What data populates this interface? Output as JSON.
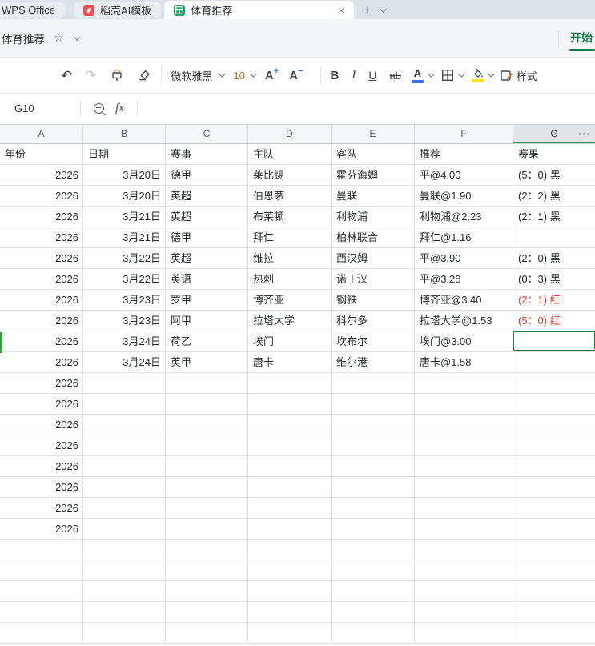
{
  "window_tabs": {
    "tabs": [
      {
        "label": "WPS Office",
        "icon": null,
        "active": false
      },
      {
        "label": "稻壳AI模板",
        "icon": "docer-leaf",
        "active": false
      },
      {
        "label": "体育推荐",
        "icon": "spreadsheet-grid",
        "active": true,
        "close_glyph": "×"
      }
    ],
    "new_tab_label": "+"
  },
  "title_bar": {
    "doc_title": "体育推荐",
    "star_glyph": "☆",
    "ribbon_active_tab": "开始"
  },
  "toolbar": {
    "undo_glyph": "↶",
    "redo_glyph": "↷",
    "font_name": "微软雅黑",
    "font_size": "10",
    "grow_font_letter": "A",
    "grow_font_sign": "+",
    "shrink_font_letter": "A",
    "shrink_font_sign": "−",
    "bold_label": "B",
    "italic_label": "I",
    "underline_label": "U",
    "strikethrough_label": "ab",
    "font_color_letter": "A",
    "styles_label": "样式"
  },
  "formula_bar": {
    "name_box": "G10",
    "fx_label": "fx"
  },
  "sheet": {
    "column_letters": [
      "A",
      "B",
      "C",
      "D",
      "E",
      "F",
      "G"
    ],
    "selected_column_index": 6,
    "selected_cell": "G10",
    "more_button": "···",
    "header_row": [
      "年份",
      "日期",
      "赛事",
      "主队",
      "客队",
      "推荐",
      "赛果"
    ],
    "rows": [
      {
        "year": "2026",
        "date": "3月20日",
        "league": "德甲",
        "home": "莱比锡",
        "away": "霍芬海姆",
        "tip": "平@4.00",
        "result": "(5：0) 黑",
        "result_color": "black",
        "selected": false
      },
      {
        "year": "2026",
        "date": "3月20日",
        "league": "英超",
        "home": "伯恩茅",
        "away": "曼联",
        "tip": "曼联@1.90",
        "result": "(2：2) 黑",
        "result_color": "black",
        "selected": false
      },
      {
        "year": "2026",
        "date": "3月21日",
        "league": "英超",
        "home": "布莱顿",
        "away": "利物浦",
        "tip": "利物浦@2.23",
        "result": "(2：1) 黑",
        "result_color": "black",
        "selected": false
      },
      {
        "year": "2026",
        "date": "3月21日",
        "league": "德甲",
        "home": "拜仁",
        "away": "柏林联合",
        "tip": "拜仁@1.16",
        "result": "",
        "result_color": "black",
        "selected": false
      },
      {
        "year": "2026",
        "date": "3月22日",
        "league": "英超",
        "home": "维拉",
        "away": "西汉姆",
        "tip": "平@3.90",
        "result": "(2：0) 黑",
        "result_color": "black",
        "selected": false
      },
      {
        "year": "2026",
        "date": "3月22日",
        "league": "英语",
        "home": "热刺",
        "away": "诺丁汉",
        "tip": "平@3.28",
        "result": "(0：3) 黑",
        "result_color": "black",
        "selected": false
      },
      {
        "year": "2026",
        "date": "3月23日",
        "league": "罗甲",
        "home": "博齐亚",
        "away": "钢铁",
        "tip": "博齐亚@3.40",
        "result": "(2：1) 红",
        "result_color": "red",
        "selected": false
      },
      {
        "year": "2026",
        "date": "3月23日",
        "league": "阿甲",
        "home": "拉塔大学",
        "away": "科尔多",
        "tip": "拉塔大学@1.53",
        "result": "(5：0) 红",
        "result_color": "red",
        "selected": false
      },
      {
        "year": "2026",
        "date": "3月24日",
        "league": "荷乙",
        "home": "埃门",
        "away": "坎布尔",
        "tip": "埃门@3.00",
        "result": "",
        "result_color": "black",
        "selected": true
      },
      {
        "year": "2026",
        "date": "3月24日",
        "league": "英甲",
        "home": "唐卡",
        "away": "维尔港",
        "tip": "唐卡@1.58",
        "result": "",
        "result_color": "black",
        "selected": false
      }
    ],
    "year_only_rows": [
      "2026",
      "2026",
      "2026",
      "2026",
      "2026",
      "2026",
      "2026",
      "2026"
    ],
    "trailing_empty_rows": 5
  },
  "colors": {
    "ribbon_green": "#107c41",
    "header_underline_green": "#21a366",
    "selection_border_green": "#17803d",
    "row_indicator_green": "#2f9e44",
    "result_red": "#ee3a2b",
    "font_size_orange": "#c8651b",
    "wps_blue": "#3370ff",
    "docer_red": "#ee5253"
  }
}
